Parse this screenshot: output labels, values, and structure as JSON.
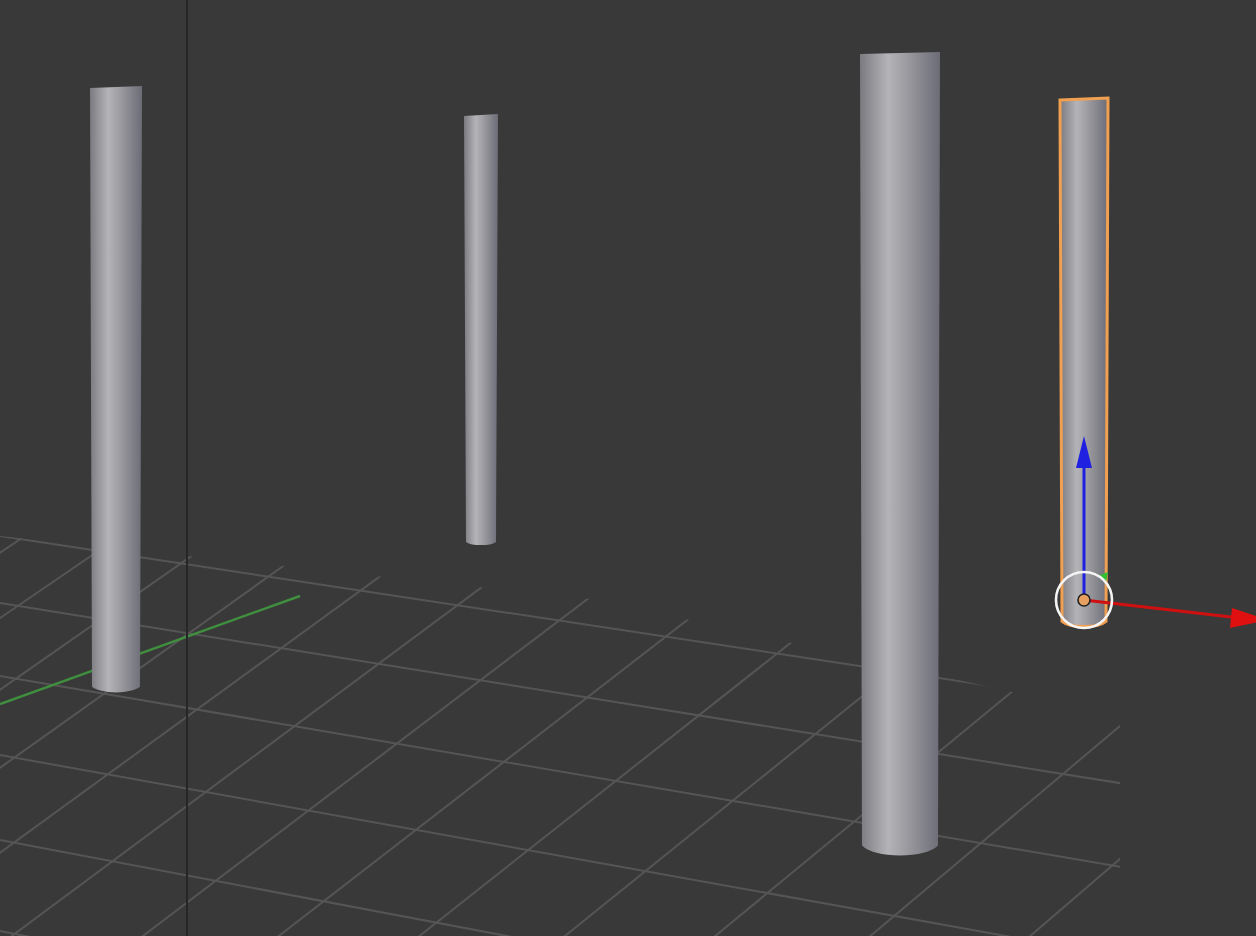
{
  "viewport": {
    "objects": [
      {
        "kind": "cylinder",
        "selected": false
      },
      {
        "kind": "cylinder",
        "selected": false
      },
      {
        "kind": "cylinder",
        "selected": false
      },
      {
        "kind": "cylinder",
        "selected": true
      }
    ]
  }
}
